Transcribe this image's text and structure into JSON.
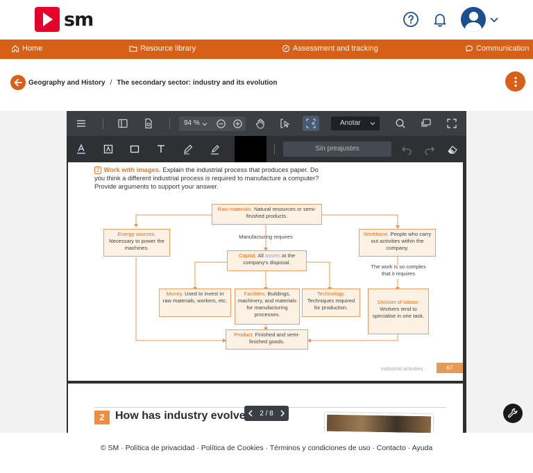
{
  "header": {
    "logo_text": "sm",
    "icons": [
      "help-icon",
      "bell-icon",
      "avatar",
      "chevron-down-icon"
    ]
  },
  "nav": {
    "items": [
      {
        "label": "Home",
        "icon": "home-icon"
      },
      {
        "label": "Resource library",
        "icon": "folder-icon"
      },
      {
        "label": "Assessment and tracking",
        "icon": "pen-check-icon"
      },
      {
        "label": "Communication",
        "icon": "chat-icon"
      }
    ]
  },
  "breadcrumb": {
    "parent": "Geography and History",
    "separator": "/",
    "current": "The secondary sector: industry and its evolution"
  },
  "viewer": {
    "zoom": "94 %",
    "mode_select": "Anotar",
    "preset_placeholder": "Sin preajustes",
    "pager": {
      "current": "2",
      "separator": "/",
      "total": "8"
    }
  },
  "page1": {
    "question_number": "2",
    "question_lead": "Work with images.",
    "question_text": "Explain the industrial process that produces paper. Do you think a different industrial process is required to manufacture a computer? Provide arguments to support your answer.",
    "diagram": {
      "raw": {
        "title": "Raw materials.",
        "text": "Natural resources or semi-finished products."
      },
      "energy": {
        "title": "Energy sources.",
        "text": "Necessary to power the machines."
      },
      "workforce": {
        "title": "Workforce.",
        "text": "People who carry out activities within the company."
      },
      "manufacturing_label": "Manufacturing requires",
      "capital": {
        "title": "Capital.",
        "pre": "All",
        "mid": "assets",
        "text": "at the company's disposal."
      },
      "complex_label": "The work is so complex that it requires",
      "money": {
        "title": "Money.",
        "text": "Used to invest in raw materials, workers, etc."
      },
      "facilities": {
        "title": "Facilities.",
        "text": "Buildings, machinery, and materials for manufacturing processes."
      },
      "technology": {
        "title": "Technology.",
        "text": "Techniques required for production."
      },
      "division": {
        "title": "Division of labour.",
        "text": "Workers tend to specialise in one task."
      },
      "product": {
        "title": "Product.",
        "text": "Finished and semi-finished goods."
      }
    },
    "footer_note": "Industrial activities",
    "page_number": "67"
  },
  "page2": {
    "section_number": "2",
    "section_title": "How has industry evolved?"
  },
  "footer": {
    "text": "© SM · Política de privacidad · Política de Cookies · Términos y condiciones de uso · Contacto · Ayuda"
  },
  "colors": {
    "brand_orange": "#d85f18",
    "logo_red": "#e4002b",
    "diagram_orange": "#e57d2c"
  }
}
